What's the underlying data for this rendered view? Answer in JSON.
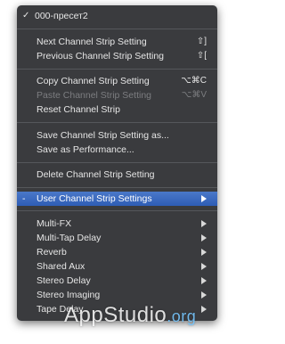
{
  "menu": {
    "preset": {
      "check": "✓",
      "label": "000-пресет2"
    },
    "items": [
      {
        "label": "Next Channel Strip Setting",
        "shortcut": "⇧]"
      },
      {
        "label": "Previous Channel Strip Setting",
        "shortcut": "⇧["
      },
      {
        "label": "Copy Channel Strip Setting",
        "shortcut": "⌥⌘C"
      },
      {
        "label": "Paste Channel Strip Setting",
        "shortcut": "⌥⌘V"
      },
      {
        "label": "Reset Channel Strip"
      },
      {
        "label": "Save Channel Strip Setting as..."
      },
      {
        "label": "Save as Performance..."
      },
      {
        "label": "Delete Channel Strip Setting"
      },
      {
        "label": "User Channel Strip Settings",
        "prefix": "-"
      }
    ],
    "submenus": [
      {
        "label": "Multi-FX"
      },
      {
        "label": "Multi-Tap Delay"
      },
      {
        "label": "Reverb"
      },
      {
        "label": "Shared Aux"
      },
      {
        "label": "Stereo Delay"
      },
      {
        "label": "Stereo Imaging"
      },
      {
        "label": "Tape Delay"
      }
    ]
  },
  "watermark": {
    "text": "AppStudio",
    "suffix": ".org"
  }
}
